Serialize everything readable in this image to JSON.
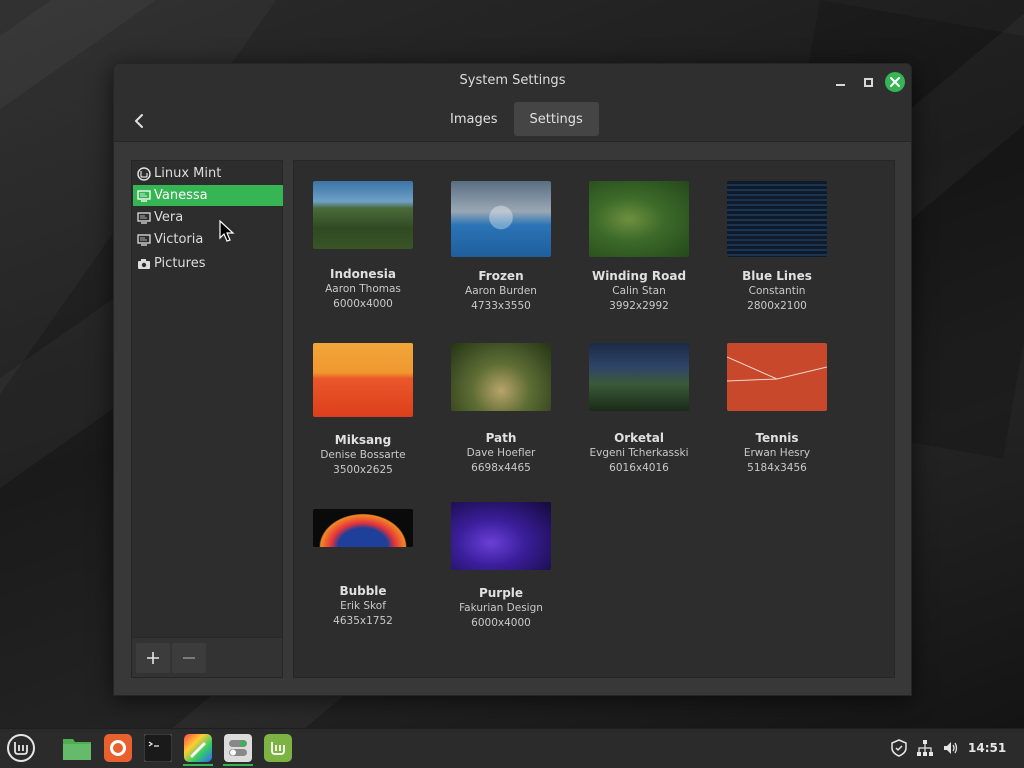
{
  "window": {
    "title": "System Settings"
  },
  "tabs": [
    {
      "label": "Images",
      "active": false
    },
    {
      "label": "Settings",
      "active": true
    }
  ],
  "sidebar": {
    "items": [
      {
        "label": "Linux Mint",
        "icon": "mint-logo-icon",
        "selected": false
      },
      {
        "label": "Vanessa",
        "icon": "monitor-icon",
        "selected": true
      },
      {
        "label": "Vera",
        "icon": "monitor-icon",
        "selected": false
      },
      {
        "label": "Victoria",
        "icon": "monitor-icon",
        "selected": false
      },
      {
        "label": "Pictures",
        "icon": "camera-icon",
        "selected": false
      }
    ],
    "add_label": "+",
    "remove_label": "−"
  },
  "wallpapers": [
    {
      "name": "Indonesia",
      "author": "Aaron Thomas",
      "resolution": "6000x4000"
    },
    {
      "name": "Frozen",
      "author": "Aaron Burden",
      "resolution": "4733x3550"
    },
    {
      "name": "Winding Road",
      "author": "Calin Stan",
      "resolution": "3992x2992"
    },
    {
      "name": "Blue Lines",
      "author": "Constantin",
      "resolution": "2800x2100"
    },
    {
      "name": "Miksang",
      "author": "Denise Bossarte",
      "resolution": "3500x2625"
    },
    {
      "name": "Path",
      "author": "Dave Hoefler",
      "resolution": "6698x4465"
    },
    {
      "name": "Orketal",
      "author": "Evgeni Tcherkasski",
      "resolution": "6016x4016"
    },
    {
      "name": "Tennis",
      "author": "Erwan Hesry",
      "resolution": "5184x3456"
    },
    {
      "name": "Bubble",
      "author": "Erik Skof",
      "resolution": "4635x1752"
    },
    {
      "name": "Purple",
      "author": "Fakurian Design",
      "resolution": "6000x4000"
    }
  ],
  "taskbar": {
    "apps": [
      "mint-menu-icon",
      "files-icon",
      "firefox-icon",
      "terminal-icon",
      "paint-icon",
      "settings-toggle-icon",
      "mint-update-icon"
    ],
    "clock": "14:51"
  },
  "colors": {
    "accent": "#35b553",
    "window_bg": "#383838",
    "panel_bg": "#2d2d2d"
  }
}
